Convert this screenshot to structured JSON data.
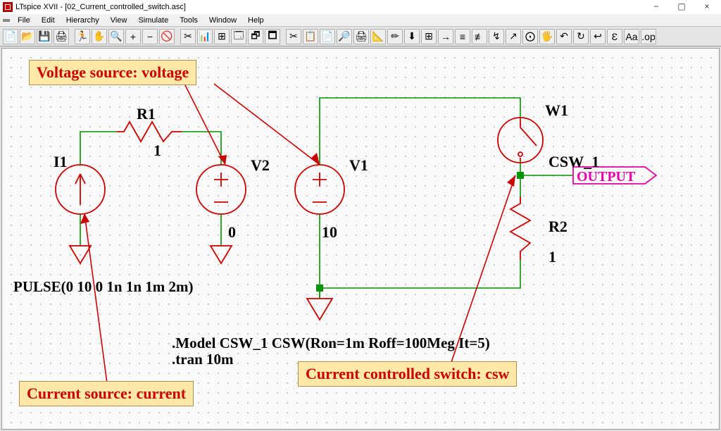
{
  "window": {
    "title": "LTspice XVII - [02_Current_controlled_switch.asc]",
    "sys_minimize": "−",
    "sys_maximize": "▢",
    "sys_close": "×"
  },
  "menu": {
    "items": [
      "File",
      "Edit",
      "Hierarchy",
      "View",
      "Simulate",
      "Tools",
      "Window",
      "Help"
    ]
  },
  "toolbar": {
    "items": [
      "📄",
      "📂",
      "💾",
      "🖨",
      "🏃",
      "✋",
      "🔍",
      "+",
      "−",
      "🚫",
      "✂",
      "📊",
      "⊞",
      "🗔",
      "🗗",
      "🗖",
      "✂",
      "📋",
      "📄",
      "🔎",
      "🖨",
      "📐",
      "✏",
      "⬇",
      "⊞",
      "→",
      "≡",
      "≢",
      "↯",
      "↗",
      "⨀",
      "🖐",
      "↶",
      "↻",
      "↩",
      "Ɛ",
      "Aa",
      ".op"
    ]
  },
  "schematic": {
    "components": {
      "I1": {
        "ref": "I1",
        "value": "PULSE(0 10 0 1n 1n 1m 2m)"
      },
      "R1": {
        "ref": "R1",
        "value": "1"
      },
      "V2": {
        "ref": "V2",
        "value": "0"
      },
      "V1": {
        "ref": "V1",
        "value": "10"
      },
      "W1": {
        "ref": "W1",
        "model": "CSW_1"
      },
      "R2": {
        "ref": "R2",
        "value": "1"
      }
    },
    "net_label": "OUTPUT",
    "directives": {
      "model": ".Model CSW_1 CSW(Ron=1m Roff=100Meg It=5)",
      "tran": ".tran 10m"
    }
  },
  "callouts": {
    "voltage": "Voltage source: voltage",
    "current": "Current source: current",
    "switch": "Current controlled switch: csw"
  }
}
